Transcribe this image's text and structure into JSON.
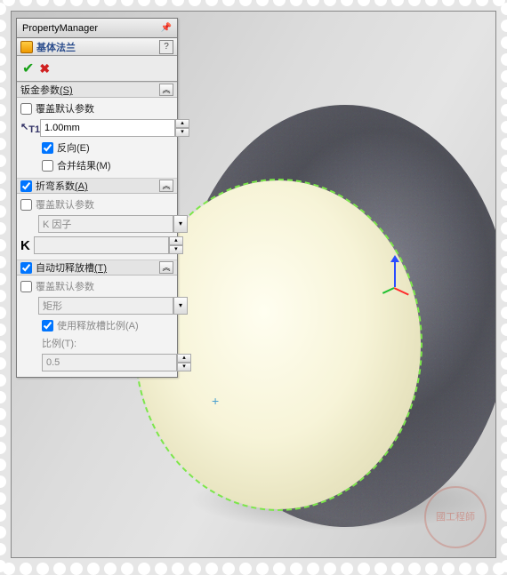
{
  "panel_title": "PropertyManager",
  "feature": {
    "title": "基体法兰"
  },
  "ok_glyph": "✔",
  "cancel_glyph": "✖",
  "help_glyph": "?",
  "chevron_glyph": "︽",
  "pin_glyph": "📌",
  "sections": {
    "sheet_metal": {
      "header": "钣金参数",
      "header_key": "(S)",
      "override_label": "覆盖默认参数",
      "override_checked": false,
      "thickness_icon": "T1",
      "thickness_value": "1.00mm",
      "reverse_label": "反向",
      "reverse_key": "(E)",
      "reverse_checked": true,
      "merge_label": "合并结果",
      "merge_key": "(M)",
      "merge_checked": false
    },
    "bend_allowance": {
      "header": "折弯系数",
      "header_key": "(A)",
      "header_checked": true,
      "override_label": "覆盖默认参数",
      "override_checked": false,
      "type_value": "K 因子",
      "k_label": "K",
      "k_value": ""
    },
    "auto_relief": {
      "header": "自动切释放槽",
      "header_key": "(T)",
      "header_checked": true,
      "override_label": "覆盖默认参数",
      "override_checked": false,
      "type_value": "矩形",
      "use_ratio_label": "使用释放槽比例",
      "use_ratio_key": "(A)",
      "use_ratio_checked": true,
      "ratio_label": "比例",
      "ratio_key": "(T):",
      "ratio_value": "0.5"
    }
  },
  "watermark_text": "國工程師"
}
